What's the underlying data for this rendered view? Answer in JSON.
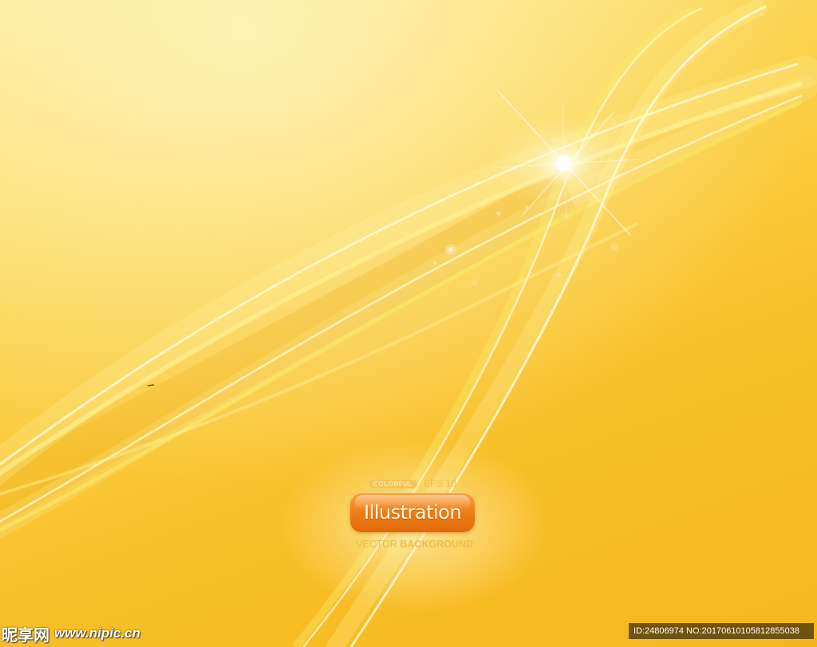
{
  "badge": {
    "top_pill": "COLORFUL",
    "top_suffix": "EPS 10",
    "title": "Illustration",
    "sub_regular": "VECTOR",
    "sub_bold": "BACKGROUND"
  },
  "watermark": {
    "brand_cn": "昵享网",
    "url": "www.nipic.cn",
    "id_text": "ID:24806974 NO:20170610105812855038"
  },
  "colors": {
    "background": "#f8c02a",
    "badge_orange": "#ee7b12",
    "highlight": "#fff9d8"
  }
}
